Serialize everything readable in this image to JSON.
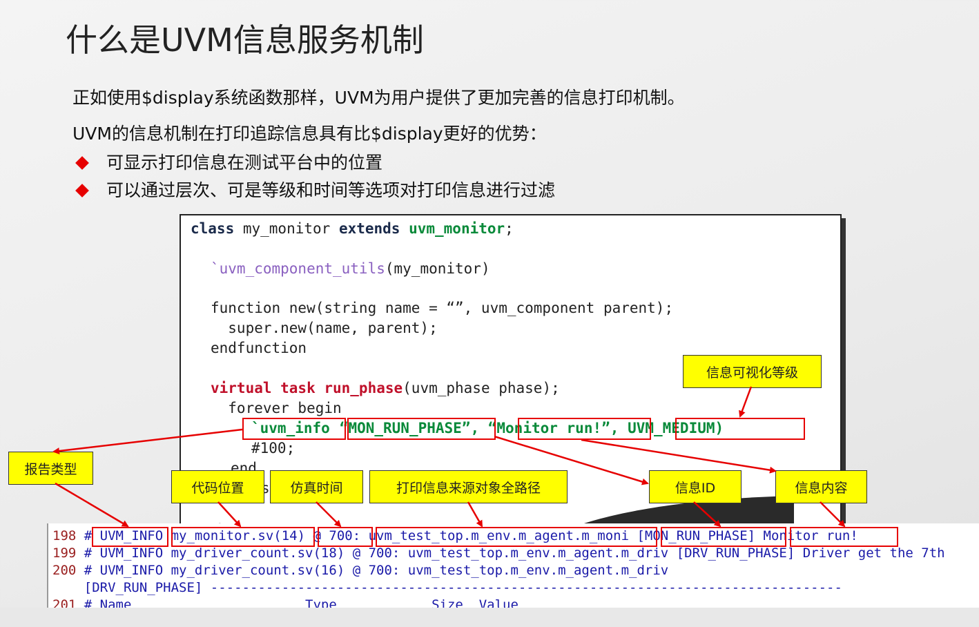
{
  "slide": {
    "title": "什么是UVM信息服务机制",
    "paragraph1": "正如使用$display系统函数那样，UVM为用户提供了更加完善的信息打印机制。",
    "paragraph2": "UVM的信息机制在打印追踪信息具有比$display更好的优势：",
    "bullets": [
      "可显示打印信息在测试平台中的位置",
      "可以通过层次、可是等级和时间等选项对打印信息进行过滤"
    ]
  },
  "code": {
    "l1_kw1": "class",
    "l1_name": " my_monitor ",
    "l1_kw2": "extends",
    "l1_base": " uvm_monitor",
    "l1_semi": ";",
    "l2_macro": "`uvm_component_utils",
    "l2_arg": "(my_monitor)",
    "l3": "function new(string name = “”, uvm_component parent);",
    "l4": "  super.new(name, parent);",
    "l5": "endfunction",
    "l6_kw": "virtual task run_phase",
    "l6_rest": "(uvm_phase phase);",
    "l7": "  forever begin",
    "l8_macro": "`uvm_info",
    "l8_id": "“MON_RUN_PHASE”",
    "l8_sep1": ", ",
    "l8_msg": "“Monitor run!”",
    "l8_sep2": ", ",
    "l8_verb": "UVM_MEDIUM)",
    "l9": "#100;",
    "l10": "end",
    "l11": "s",
    "l12": "."
  },
  "log": {
    "lines": [
      {
        "num": "198",
        "text": " # UVM_INFO my_monitor.sv(14) @ 700: uvm_test_top.m_env.m_agent.m_moni [MON_RUN_PHASE] Monitor run!"
      },
      {
        "num": "199",
        "text": " # UVM_INFO my_driver_count.sv(18) @ 700: uvm_test_top.m_env.m_agent.m_driv [DRV_RUN_PHASE] Driver get the 7th"
      },
      {
        "num": "200",
        "text": " # UVM_INFO my_driver_count.sv(16) @ 700: uvm_test_top.m_env.m_agent.m_driv"
      },
      {
        "num": "",
        "text": "    [DRV_RUN_PHASE] --------------------------------------------------------------------------------"
      },
      {
        "num": "201",
        "text": " # Name                      Type            Size  Value"
      }
    ]
  },
  "callouts": {
    "verbosity": "信息可视化等级",
    "report_type": "报告类型",
    "code_location": "代码位置",
    "sim_time": "仿真时间",
    "full_path": "打印信息来源对象全路径",
    "message_id": "信息ID",
    "message_content": "信息内容"
  },
  "colors": {
    "highlight": "#e60000",
    "callout_bg": "#ffff00",
    "keyword_green": "#0a8a3a",
    "keyword_red": "#c0102a",
    "log_blue": "#1a1aa8"
  }
}
